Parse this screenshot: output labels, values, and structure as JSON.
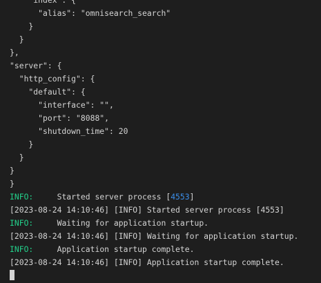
{
  "json_lines": [
    "    \"index\": {",
    "      \"alias\": \"omnisearch_search\"",
    "    }",
    "  }",
    "},",
    "\"server\": {",
    "  \"http_config\": {",
    "    \"default\": {",
    "      \"interface\": \"\",",
    "      \"port\": \"8088\",",
    "      \"shutdown_time\": 20",
    "    }",
    "  }",
    "}"
  ],
  "closing_brace": "}",
  "log": {
    "info1": {
      "label": "INFO:",
      "pad": "     ",
      "text": "Started server process [",
      "pid": "4553",
      "suffix": "]"
    },
    "ts1": "[2023-08-24 14:10:46] [INFO] Started server process [4553]",
    "info2": {
      "label": "INFO:",
      "pad": "     ",
      "text": "Waiting for application startup."
    },
    "ts2": "[2023-08-24 14:10:46] [INFO] Waiting for application startup.",
    "info3": {
      "label": "INFO:",
      "pad": "     ",
      "text": "Application startup complete."
    },
    "ts3": "[2023-08-24 14:10:46] [INFO] Application startup complete."
  },
  "colors": {
    "background": "#1e1e1e",
    "text": "#d4d4d4",
    "info": "#23d18b",
    "pid": "#3b8eea"
  }
}
